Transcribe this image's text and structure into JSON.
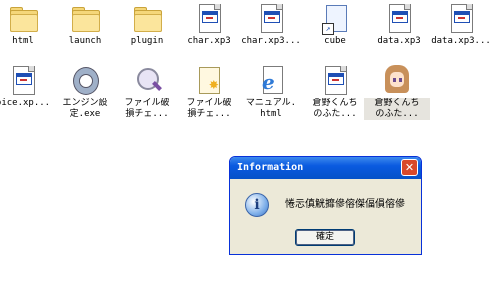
{
  "desktop": {
    "row1": [
      {
        "label": "html",
        "icon": "folder-icon"
      },
      {
        "label": "launch",
        "icon": "folder-icon"
      },
      {
        "label": "plugin",
        "icon": "folder-icon"
      },
      {
        "label": "char.xp3",
        "icon": "xp3-file-icon"
      },
      {
        "label": "char.xp3...",
        "icon": "xp3-file-icon"
      },
      {
        "label": "cube",
        "icon": "shortcut-icon"
      },
      {
        "label": "data.xp3",
        "icon": "xp3-file-icon"
      },
      {
        "label": "data.xp3...",
        "icon": "xp3-file-icon"
      }
    ],
    "row2": [
      {
        "label": "oice.xp...",
        "icon": "xp3-file-icon"
      },
      {
        "label": "エンジン設\n定.exe",
        "icon": "exe-icon"
      },
      {
        "label": "ファイル破\n損チェ...",
        "icon": "magnifier-icon"
      },
      {
        "label": "ファイル破\n損チェ...",
        "icon": "page-star-icon"
      },
      {
        "label": "マニュアル.\nhtml",
        "icon": "ie-html-icon"
      },
      {
        "label": "倉野くんち\nのふた...",
        "icon": "xp3-file-icon"
      },
      {
        "label": "倉野くんち\nのふた...",
        "icon": "anime-girl-icon"
      }
    ]
  },
  "dialog": {
    "title": "Information",
    "message": "惓忈傎觥攠傪傛傑偪傊傛傪",
    "ok_label": "確定",
    "close_symbol": "✕",
    "info_symbol": "i"
  }
}
